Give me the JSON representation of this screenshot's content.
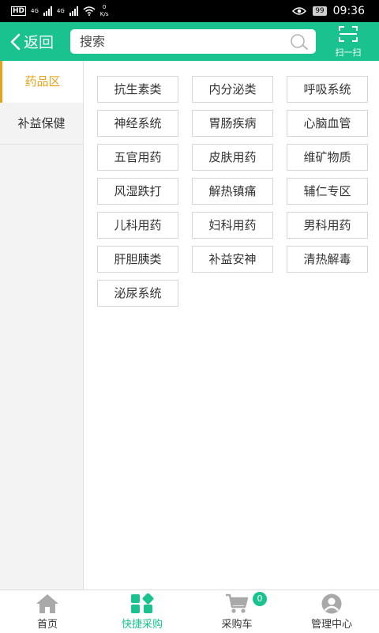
{
  "status_bar": {
    "net_type_1": "4G",
    "net_type_2": "4G",
    "net_speed_value": "0",
    "net_speed_unit": "K/s",
    "battery": "99",
    "time": "09:36"
  },
  "header": {
    "back_label": "返回",
    "search_placeholder": "搜索",
    "scan_label": "扫一扫"
  },
  "sidebar": {
    "items": [
      {
        "label": "药品区",
        "active": true
      },
      {
        "label": "补益保健",
        "active": false
      }
    ]
  },
  "categories": [
    "抗生素类",
    "内分泌类",
    "呼吸系统",
    "神经系统",
    "胃肠疾病",
    "心脑血管",
    "五官用药",
    "皮肤用药",
    "维矿物质",
    "风湿跌打",
    "解热镇痛",
    "辅仁专区",
    "儿科用药",
    "妇科用药",
    "男科用药",
    "肝胆胰类",
    "补益安神",
    "清热解毒",
    "泌尿系统"
  ],
  "tabbar": {
    "items": [
      {
        "label": "首页",
        "icon": "home-icon",
        "active": false
      },
      {
        "label": "快捷采购",
        "icon": "grid-icon",
        "active": true
      },
      {
        "label": "采购车",
        "icon": "cart-icon",
        "active": false
      },
      {
        "label": "管理中心",
        "icon": "user-icon",
        "active": false
      }
    ],
    "cart_count": "0"
  },
  "colors": {
    "brand_green": "#19c28e",
    "active_orange": "#e8a21a",
    "inactive_icon": "#a9a9a9"
  }
}
